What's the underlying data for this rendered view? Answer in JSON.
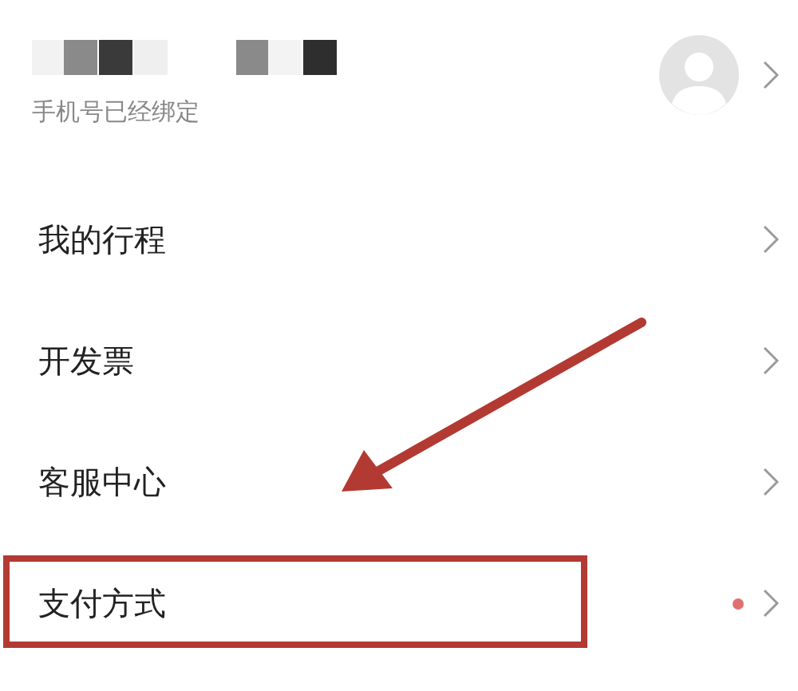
{
  "profile": {
    "status": "手机号已经绑定"
  },
  "menu_items": [
    {
      "label": "我的行程",
      "dot": false,
      "highlighted": false
    },
    {
      "label": "开发票",
      "dot": false,
      "highlighted": false
    },
    {
      "label": "客服中心",
      "dot": false,
      "highlighted": false
    },
    {
      "label": "支付方式",
      "dot": true,
      "highlighted": true
    }
  ]
}
